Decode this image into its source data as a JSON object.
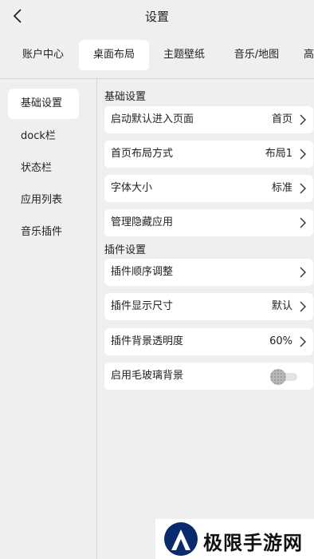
{
  "header": {
    "title": "设置"
  },
  "tabs": [
    {
      "label": "账户中心"
    },
    {
      "label": "桌面布局"
    },
    {
      "label": "主题壁纸"
    },
    {
      "label": "音乐/地图"
    },
    {
      "label": "高"
    }
  ],
  "sidebar": {
    "items": [
      {
        "label": "基础设置"
      },
      {
        "label": "dock栏"
      },
      {
        "label": "状态栏"
      },
      {
        "label": "应用列表"
      },
      {
        "label": "音乐插件"
      }
    ]
  },
  "sections": {
    "basic": {
      "title": "基础设置",
      "rows": [
        {
          "label": "启动默认进入页面",
          "value": "首页"
        },
        {
          "label": "首页布局方式",
          "value": "布局1"
        },
        {
          "label": "字体大小",
          "value": "标准"
        },
        {
          "label": "管理隐藏应用",
          "value": ""
        }
      ]
    },
    "plugin": {
      "title": "插件设置",
      "rows": [
        {
          "label": "插件顺序调整",
          "value": ""
        },
        {
          "label": "插件显示尺寸",
          "value": "默认"
        },
        {
          "label": "插件背景透明度",
          "value": "60%"
        },
        {
          "label": "启用毛玻璃背景",
          "toggle": false
        }
      ]
    }
  },
  "watermark": {
    "text": "极限手游网"
  },
  "colors": {
    "background": "#efefef",
    "card": "#ffffff",
    "divider": "#d6d6d6",
    "text": "#222222"
  },
  "icons": {
    "back": "chevron-left-icon",
    "row_arrow": "chevron-right-icon"
  }
}
